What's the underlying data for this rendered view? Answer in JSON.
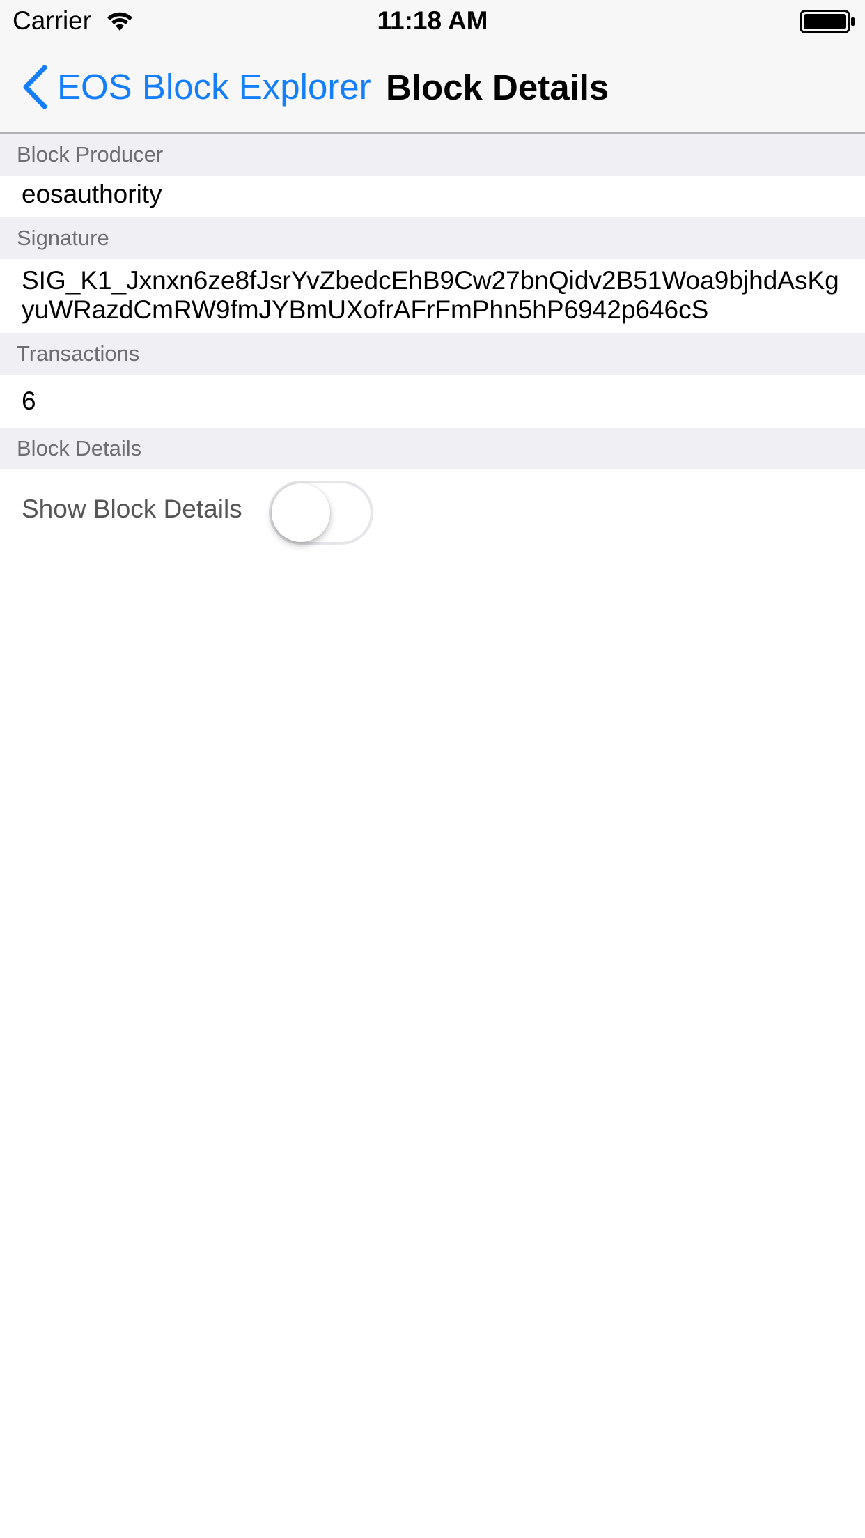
{
  "status_bar": {
    "carrier": "Carrier",
    "time": "11:18 AM",
    "wifi_icon": "wifi-icon",
    "battery_icon": "battery-icon"
  },
  "nav": {
    "back_label": "EOS Block Explorer",
    "back_icon": "chevron-left-icon",
    "title": "Block Details",
    "accent_color": "#147efb"
  },
  "sections": {
    "producer": {
      "header": "Block Producer",
      "value": "eosauthority"
    },
    "signature": {
      "header": "Signature",
      "line1": "SIG_K1_Jxnxn6ze8fJsrYvZbedcEhB9Cw27bnQidv2B51Woa9bjhdAsKg",
      "line2": "yuWRazdCmRW9fmJYBmUXofrAFrFmPhn5hP6942p646cS"
    },
    "transactions": {
      "header": "Transactions",
      "value": "6"
    },
    "block_details": {
      "header": "Block Details",
      "toggle_label": "Show Block Details",
      "toggle_on": false
    }
  }
}
